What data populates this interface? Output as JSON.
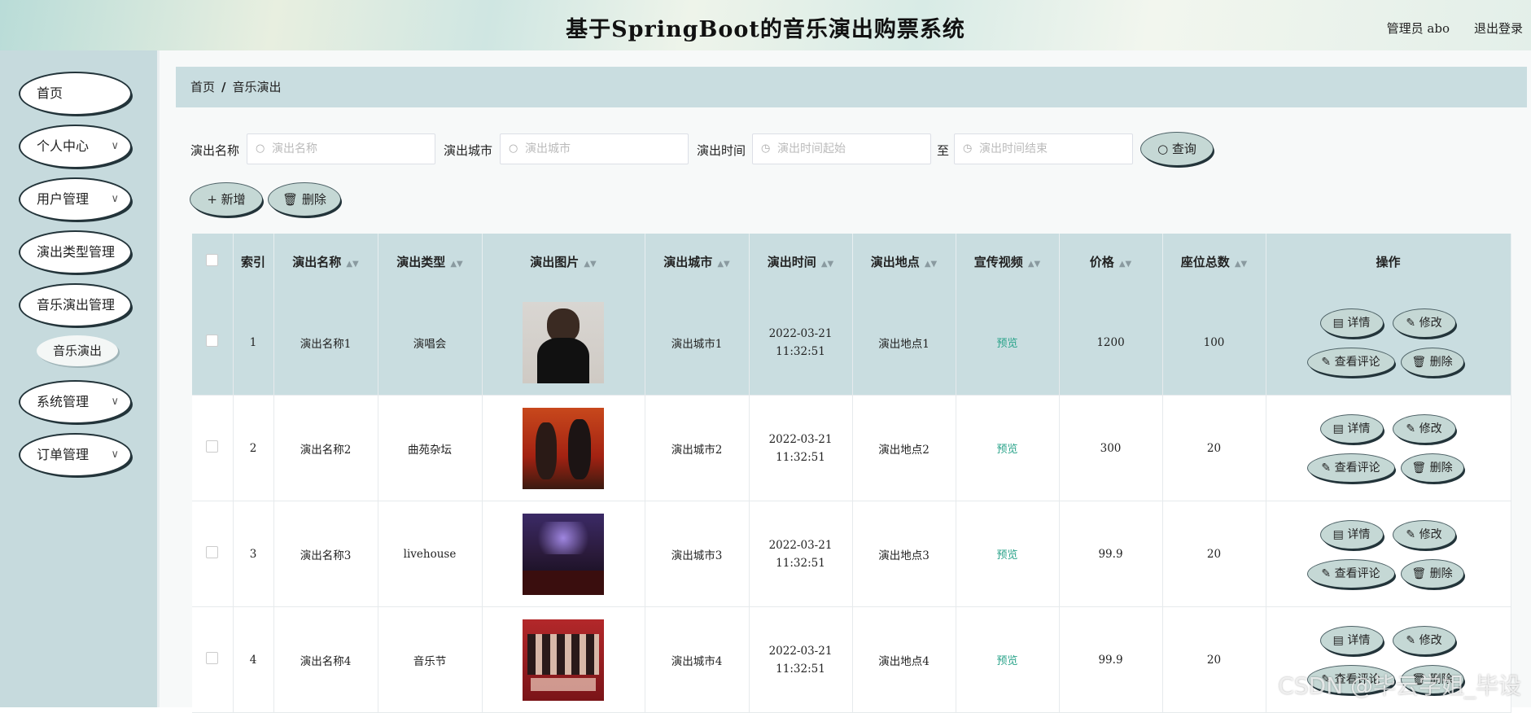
{
  "header": {
    "title": "基于SpringBoot的音乐演出购票系统",
    "admin_label": "管理员 abo",
    "logout": "退出登录"
  },
  "sidebar": {
    "items": [
      {
        "label": "首页",
        "chevron": false
      },
      {
        "label": "个人中心",
        "chevron": true
      },
      {
        "label": "用户管理",
        "chevron": true
      },
      {
        "label": "演出类型管理",
        "chevron": false
      },
      {
        "label": "音乐演出管理",
        "chevron": false
      },
      {
        "label": "系统管理",
        "chevron": true
      },
      {
        "label": "订单管理",
        "chevron": true
      }
    ],
    "sub_item": "音乐演出"
  },
  "breadcrumb": {
    "home": "首页",
    "sep": "/",
    "current": "音乐演出"
  },
  "search": {
    "name_label": "演出名称",
    "name_placeholder": "演出名称",
    "city_label": "演出城市",
    "city_placeholder": "演出城市",
    "time_label": "演出时间",
    "time_start_placeholder": "演出时间起始",
    "time_to": "至",
    "time_end_placeholder": "演出时间结束",
    "query_button": "查询"
  },
  "toolbar": {
    "add_button": "新增",
    "delete_button": "删除"
  },
  "table": {
    "headers": [
      "索引",
      "演出名称",
      "演出类型",
      "演出图片",
      "演出城市",
      "演出时间",
      "演出地点",
      "宣传视频",
      "价格",
      "座位总数",
      "操作"
    ],
    "rows": [
      {
        "index": "1",
        "name": "演出名称1",
        "type": "演唱会",
        "city": "演出城市1",
        "time": "2022-03-21 11:32:51",
        "place": "演出地点1",
        "video": "预览",
        "price": "1200",
        "seats": "100"
      },
      {
        "index": "2",
        "name": "演出名称2",
        "type": "曲苑杂坛",
        "city": "演出城市2",
        "time": "2022-03-21 11:32:51",
        "place": "演出地点2",
        "video": "预览",
        "price": "300",
        "seats": "20"
      },
      {
        "index": "3",
        "name": "演出名称3",
        "type": "livehouse",
        "city": "演出城市3",
        "time": "2022-03-21 11:32:51",
        "place": "演出地点3",
        "video": "预览",
        "price": "99.9",
        "seats": "20"
      },
      {
        "index": "4",
        "name": "演出名称4",
        "type": "音乐节",
        "city": "演出城市4",
        "time": "2022-03-21 11:32:51",
        "place": "演出地点4",
        "video": "预览",
        "price": "99.9",
        "seats": "20"
      }
    ],
    "ops": {
      "detail": "详情",
      "edit": "修改",
      "comments": "查看评论",
      "delete": "删除"
    }
  },
  "watermark": "CSDN @毕云学姐_毕设"
}
